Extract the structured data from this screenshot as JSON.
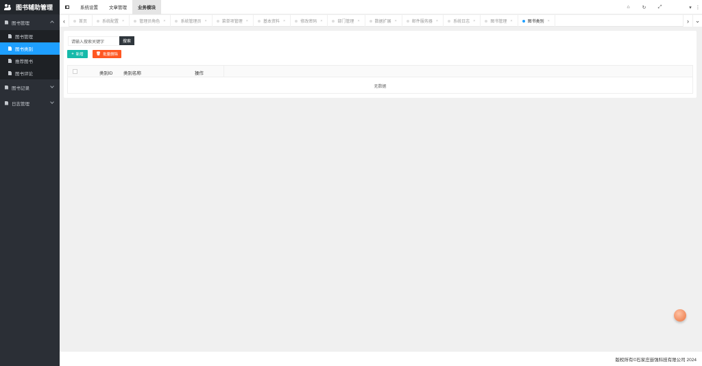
{
  "sidebar": {
    "title": "图书辅助管理",
    "groups": [
      {
        "label": "图书管理",
        "items": [
          "图书管理",
          "图书类别",
          "推荐图书",
          "图书评论"
        ]
      },
      {
        "label": "图书记录"
      },
      {
        "label": "日志管理"
      }
    ]
  },
  "topbar": {
    "tabs": [
      "系统设置",
      "文章管理",
      "业务模块"
    ],
    "active_tab": "业务模块"
  },
  "tabs": [
    "首页",
    "系统配置",
    "管理员角色",
    "系统管理员",
    "菜单项管理",
    "基本资料",
    "修改密码",
    "部门管理",
    "数据扩展",
    "邮件服务器",
    "系统日志",
    "图书管理",
    "图书类别"
  ],
  "active_page_tab": "图书类别",
  "content": {
    "search_placeholder": "请输入搜索关键字",
    "search_label": "搜索",
    "add_label": "新增",
    "batch_delete_label": "批量删除",
    "columns": [
      "类别ID",
      "类别名称",
      "操作"
    ],
    "empty_text": "无数据"
  },
  "footer": {
    "copyright": "版权所有©石家庄嵌强科技有限公司 2024"
  },
  "colors": {
    "sidebar": "#2b2f36",
    "active": "#1e9fff",
    "add": "#16baaa",
    "delete": "#ff5722"
  }
}
